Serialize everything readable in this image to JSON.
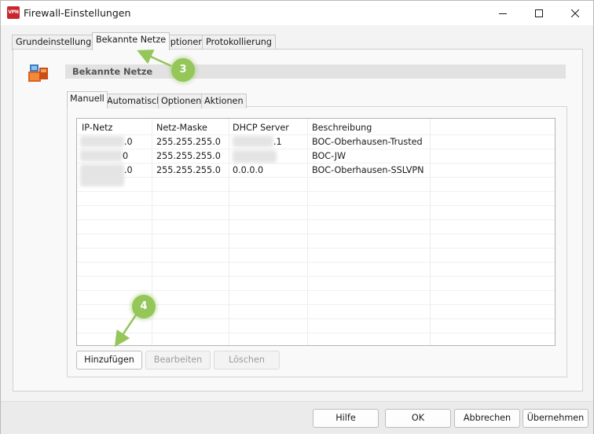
{
  "window": {
    "app_icon_text": "VPN",
    "title": "Firewall-Einstellungen"
  },
  "tabs": [
    {
      "label": "Grundeinstellungen"
    },
    {
      "label": "Bekannte Netze"
    },
    {
      "label": "Optionen"
    },
    {
      "label": "Protokollierung"
    }
  ],
  "section": {
    "title": "Bekannte Netze"
  },
  "inner_tabs": [
    {
      "label": "Manuell"
    },
    {
      "label": "Automatisch"
    },
    {
      "label": "Optionen"
    },
    {
      "label": "Aktionen"
    }
  ],
  "table": {
    "columns": [
      "IP-Netz",
      "Netz-Maske",
      "DHCP Server",
      "Beschreibung"
    ],
    "rows": [
      {
        "ip": ".0",
        "mask": "255.255.255.0",
        "dhcp": ".1",
        "desc": "BOC-Oberhausen-Trusted"
      },
      {
        "ip": "0",
        "mask": "255.255.255.0",
        "dhcp": "",
        "desc": "BOC-JW"
      },
      {
        "ip": ".0",
        "mask": "255.255.255.0",
        "dhcp": "0.0.0.0",
        "desc": "BOC-Oberhausen-SSLVPN"
      }
    ]
  },
  "actions": {
    "add": "Hinzufügen",
    "edit": "Bearbeiten",
    "delete": "Löschen"
  },
  "footer": {
    "help": "Hilfe",
    "ok": "OK",
    "cancel": "Abbrechen",
    "apply": "Übernehmen"
  },
  "callouts": [
    {
      "number": "3"
    },
    {
      "number": "4"
    }
  ],
  "colors": {
    "callout": "#94c65a",
    "app_icon": "#c8282c"
  }
}
